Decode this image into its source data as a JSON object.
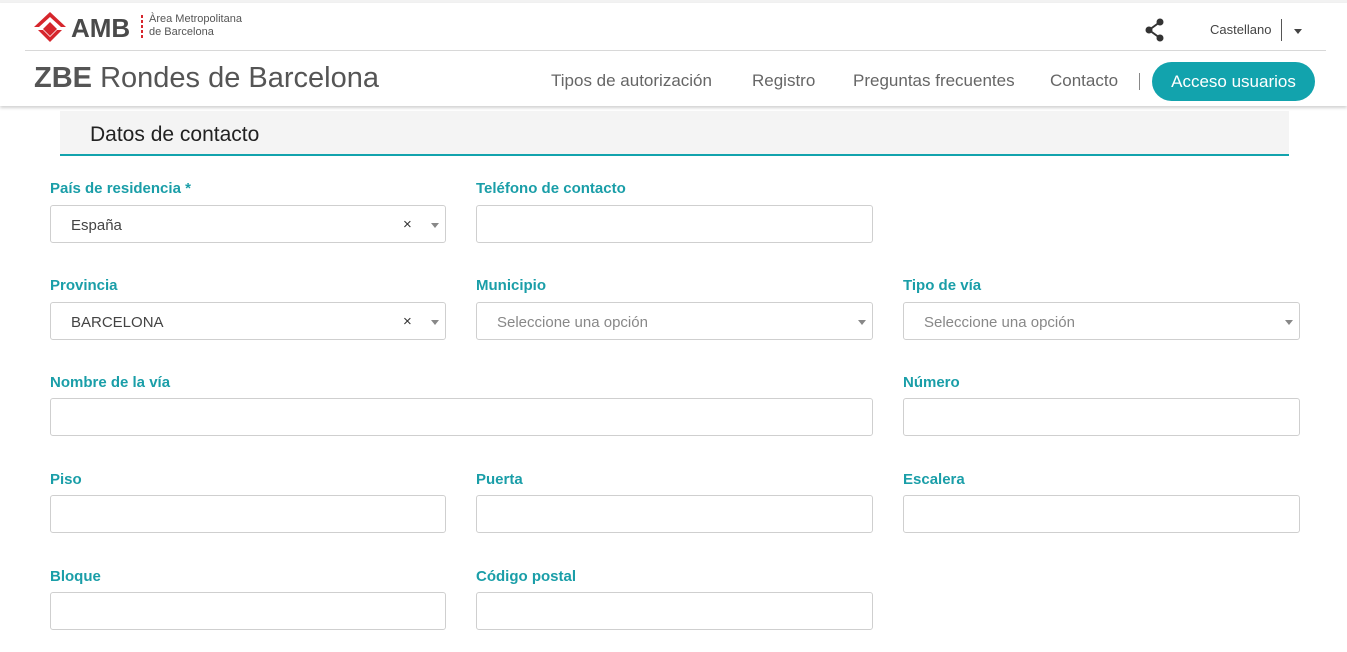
{
  "header": {
    "logo_text": "AMB",
    "logo_subtitle_line1": "Àrea Metropolitana",
    "logo_subtitle_line2": "de Barcelona",
    "language": "Castellano",
    "site_title_bold": "ZBE",
    "site_title": "Rondes de Barcelona",
    "nav": [
      "Tipos de autorización",
      "Registro",
      "Preguntas frecuentes",
      "Contacto"
    ],
    "access_button": "Acceso usuarios"
  },
  "section": {
    "title": "Datos de contacto"
  },
  "form": {
    "pais": {
      "label": "País de residencia *",
      "value": "España"
    },
    "telefono": {
      "label": "Teléfono de contacto",
      "value": ""
    },
    "provincia": {
      "label": "Provincia",
      "value": "BARCELONA"
    },
    "municipio": {
      "label": "Municipio",
      "placeholder": "Seleccione una opción"
    },
    "tipo_via": {
      "label": "Tipo de vía",
      "placeholder": "Seleccione una opción"
    },
    "nombre_via": {
      "label": "Nombre de la vía",
      "value": ""
    },
    "numero": {
      "label": "Número",
      "value": ""
    },
    "piso": {
      "label": "Piso",
      "value": ""
    },
    "puerta": {
      "label": "Puerta",
      "value": ""
    },
    "escalera": {
      "label": "Escalera",
      "value": ""
    },
    "bloque": {
      "label": "Bloque",
      "value": ""
    },
    "codigo_postal": {
      "label": "Código postal",
      "value": ""
    },
    "clear_symbol": "×"
  },
  "colors": {
    "accent": "#12a3ad",
    "label": "#1a9ea8",
    "brand_red": "#d6262d"
  },
  "icons": {
    "share": "share-icon",
    "logo": "amb-diamond-logo-icon",
    "dropdown": "chevron-down-icon",
    "clear": "close-icon"
  }
}
